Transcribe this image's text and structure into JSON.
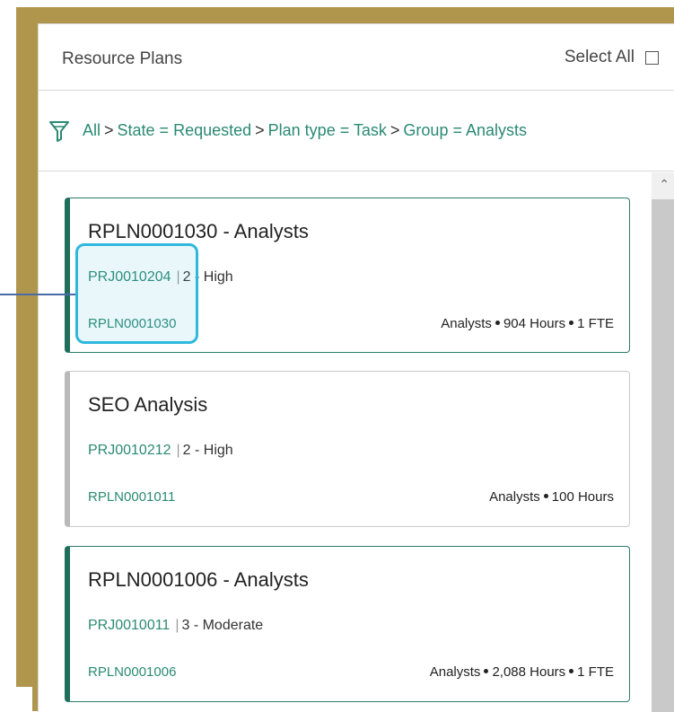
{
  "header": {
    "title": "Resource Plans",
    "select_all_label": "Select All"
  },
  "filter": {
    "icon": "funnel-icon",
    "crumbs": [
      "All",
      "State = Requested",
      "Plan type = Task",
      "Group = Analysts"
    ],
    "separator": ">"
  },
  "cards": [
    {
      "title": "RPLN0001030 - Analysts",
      "project": "PRJ0010204",
      "priority": "2 - High",
      "reference": "RPLN0001030",
      "stats": [
        "Analysts",
        "904 Hours",
        "1 FTE"
      ],
      "accent": "#1f6e5c"
    },
    {
      "title": "SEO Analysis",
      "project": "PRJ0010212",
      "priority": "2 - High",
      "reference": "RPLN0001011",
      "stats": [
        "Analysts",
        "100 Hours"
      ],
      "accent": "#b9b9b9"
    },
    {
      "title": "RPLN0001006 - Analysts",
      "project": "PRJ0010011",
      "priority": "3 - Moderate",
      "reference": "RPLN0001006",
      "stats": [
        "Analysts",
        "2,088 Hours",
        "1 FTE"
      ],
      "accent": "#1f6e5c"
    }
  ],
  "colors": {
    "link": "#2a8a72",
    "frame": "#b0954d",
    "highlight": "#2fb8dc"
  }
}
